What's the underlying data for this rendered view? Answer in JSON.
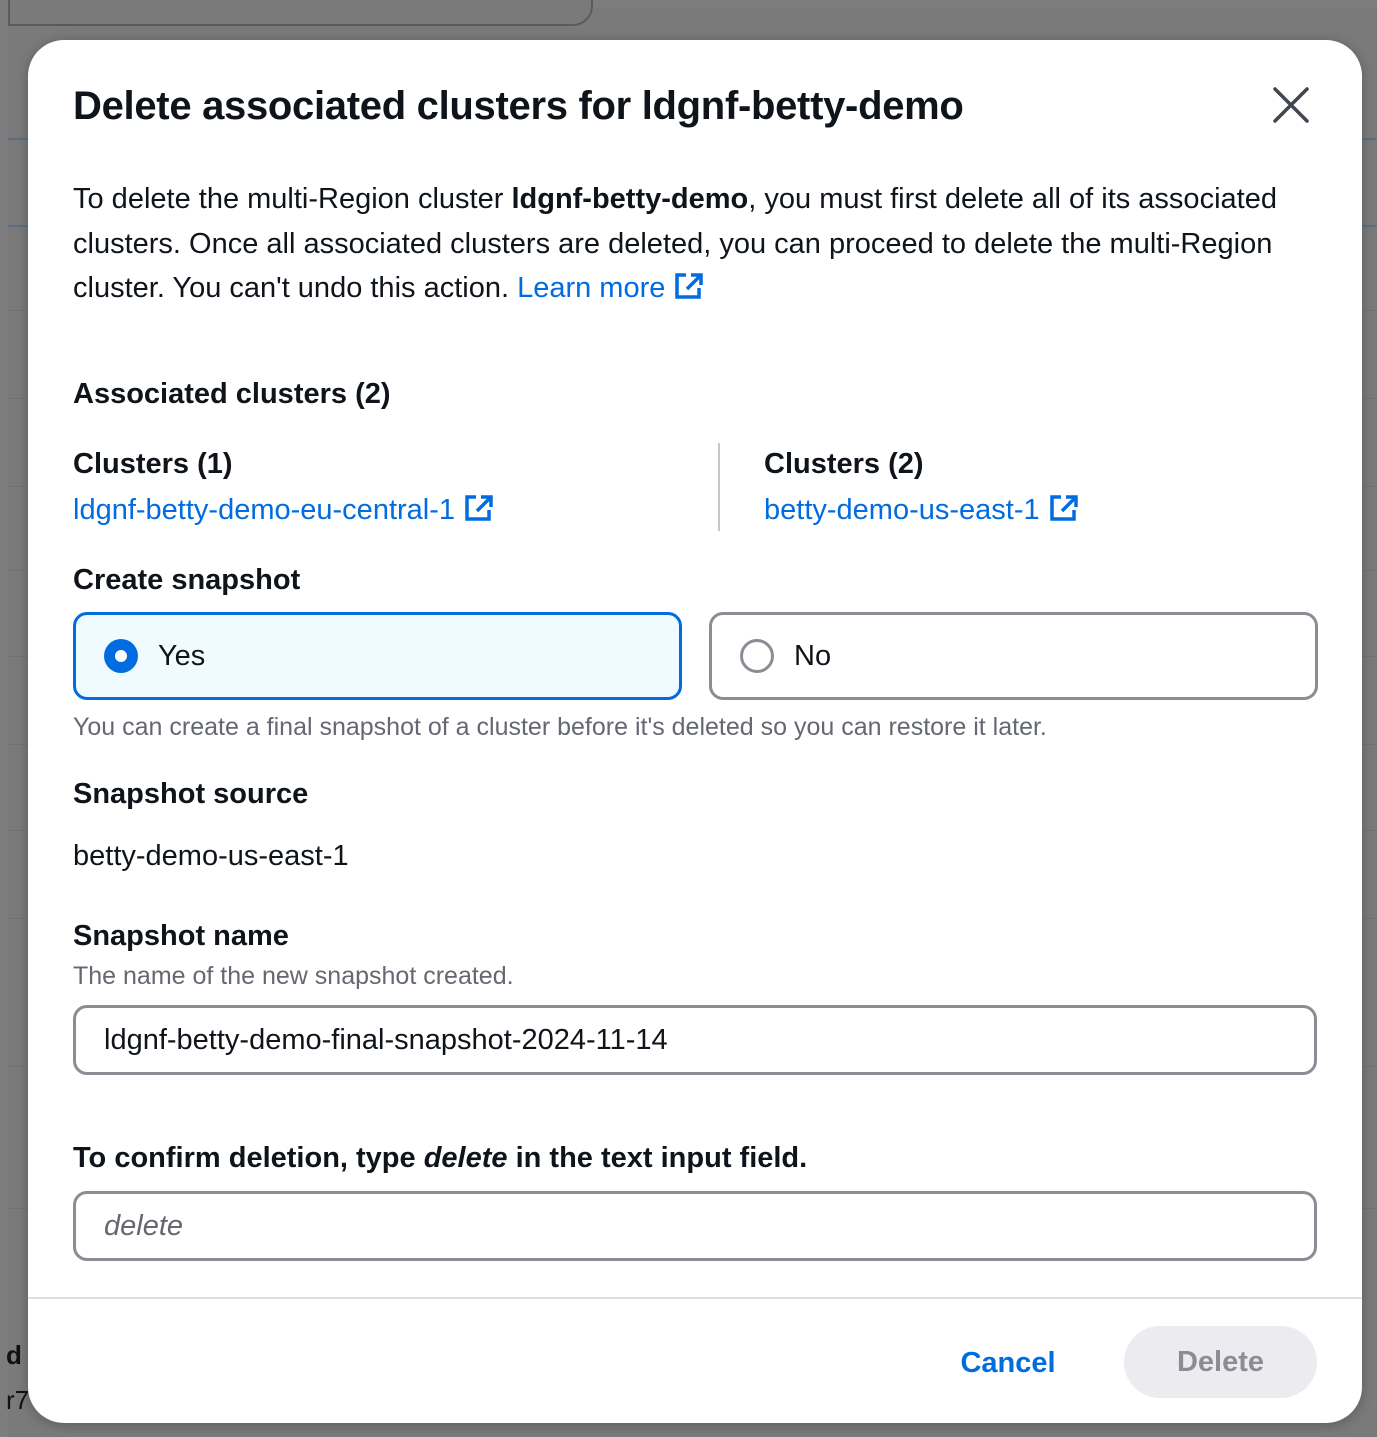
{
  "background": {
    "partial_text_left_1": "d",
    "partial_text_left_2": "r7"
  },
  "modal": {
    "title": "Delete associated clusters for ldgnf-betty-demo",
    "close_icon": "close-icon",
    "description": {
      "part1": "To delete the multi-Region cluster ",
      "cluster_name": "ldgnf-betty-demo",
      "part2": ", you must first delete all of its associated clusters. Once all associated clusters are deleted, you can proceed to delete the multi-Region cluster. You can't undo this action. ",
      "learn_more": "Learn more"
    },
    "associated": {
      "heading": "Associated clusters (2)",
      "columns": [
        {
          "title": "Clusters (1)",
          "link": "ldgnf-betty-demo-eu-central-1"
        },
        {
          "title": "Clusters (2)",
          "link": "betty-demo-us-east-1"
        }
      ]
    },
    "snapshot": {
      "heading": "Create snapshot",
      "options": [
        {
          "label": "Yes",
          "selected": true
        },
        {
          "label": "No",
          "selected": false
        }
      ],
      "hint": "You can create a final snapshot of a cluster before it's deleted so you can restore it later."
    },
    "snapshot_source": {
      "label": "Snapshot source",
      "value": "betty-demo-us-east-1"
    },
    "snapshot_name": {
      "label": "Snapshot name",
      "description": "The name of the new snapshot created.",
      "value": "ldgnf-betty-demo-final-snapshot-2024-11-14"
    },
    "confirm": {
      "label_before": "To confirm deletion, type ",
      "label_keyword": "delete",
      "label_after": " in the text input field.",
      "placeholder": "delete"
    },
    "footer": {
      "cancel": "Cancel",
      "delete": "Delete"
    }
  },
  "colors": {
    "link": "#006ce0",
    "selected_tile_bg": "#f0fbff",
    "disabled_button_bg": "#ebebf0"
  }
}
